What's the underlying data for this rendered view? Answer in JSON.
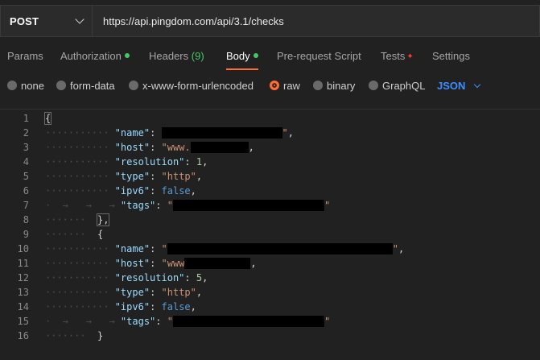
{
  "request": {
    "method": "POST",
    "url": "https://api.pingdom.com/api/3.1/checks"
  },
  "tabs": [
    {
      "label": "Params"
    },
    {
      "label": "Authorization"
    },
    {
      "label": "Headers",
      "count": "(9)"
    },
    {
      "label": "Body"
    },
    {
      "label": "Pre-request Script"
    },
    {
      "label": "Tests"
    },
    {
      "label": "Settings"
    }
  ],
  "body_modes": {
    "none": "none",
    "form_data": "form-data",
    "urlencoded": "x-www-form-urlencoded",
    "raw": "raw",
    "binary": "binary",
    "graphql": "GraphQL",
    "format": "JSON"
  },
  "editor": {
    "line_numbers": [
      "1",
      "2",
      "3",
      "4",
      "5",
      "6",
      "7",
      "8",
      "9",
      "10",
      "11",
      "12",
      "13",
      "14",
      "15",
      "16"
    ],
    "tokens": {
      "open_brace": "{",
      "close_brace": "}",
      "close_brace_comma": "},",
      "k_name": "\"name\"",
      "k_host": "\"host\"",
      "k_resolution": "\"resolution\"",
      "k_type": "\"type\"",
      "k_ipv6": "\"ipv6\"",
      "k_tags": "\"tags\"",
      "host_prefix_1": "\"www.",
      "host_prefix_2": "\"www",
      "resolution_1": "1",
      "resolution_2": "5",
      "type_val": "\"http\"",
      "ipv6_val": "false"
    }
  },
  "colors": {
    "accent": "#ff6c37",
    "status_ok": "#44c767",
    "link_blue": "#3d8eff",
    "background": "#212121"
  }
}
